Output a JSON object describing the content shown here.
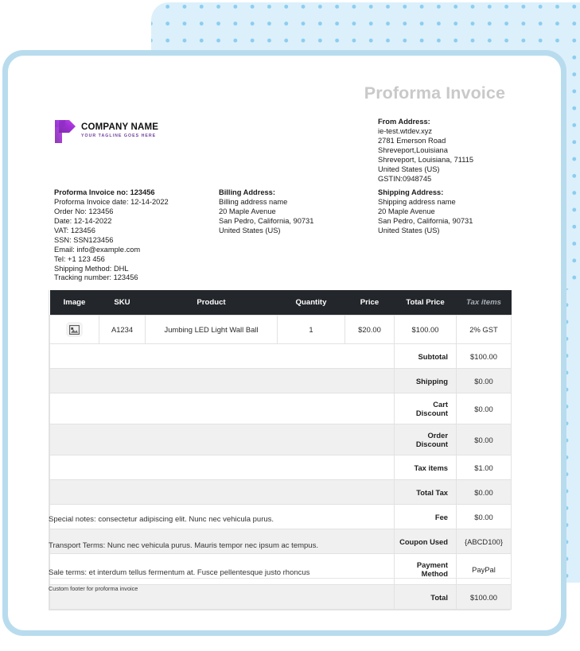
{
  "document": {
    "title": "Proforma Invoice"
  },
  "logo": {
    "name": "COMPANY NAME",
    "tagline": "YOUR TAGLINE GOES HERE",
    "mark_icon": "arrow-flag-logo-icon",
    "color_primary": "#a12fd6",
    "color_secondary": "#6d3f9e",
    "color_accent": "#3ecde0"
  },
  "from_address": {
    "heading": "From Address:",
    "lines": [
      "ie-test.wtdev.xyz",
      "2781 Emerson Road",
      "Shreveport,Louisiana",
      "Shreveport, Louisiana, 71115",
      "United States (US)",
      "GSTIN:0948745"
    ]
  },
  "invoice_info": {
    "heading": "Proforma Invoice no: 123456",
    "lines": [
      "Proforma Invoice date: 12-14-2022",
      "Order No: 123456",
      "Date: 12-14-2022",
      "VAT: 123456",
      "SSN: SSN123456",
      "Email: info@example.com",
      "Tel: +1 123 456",
      "Shipping Method: DHL",
      "Tracking number: 123456"
    ]
  },
  "billing_address": {
    "heading": "Billing Address:",
    "lines": [
      "Billing address name",
      "20 Maple Avenue",
      "San Pedro, California, 90731",
      "United States (US)"
    ]
  },
  "shipping_address": {
    "heading": "Shipping Address:",
    "lines": [
      "Shipping address name",
      "20 Maple Avenue",
      "San Pedro, California, 90731",
      "United States (US)"
    ]
  },
  "table": {
    "headers": {
      "image": "Image",
      "sku": "SKU",
      "product": "Product",
      "quantity": "Quantity",
      "price": "Price",
      "total_price": "Total Price",
      "tax_items": "Tax items"
    },
    "rows": [
      {
        "image_icon": "image-placeholder-icon",
        "sku": "A1234",
        "product": "Jumbing LED Light Wall Ball",
        "quantity": "1",
        "price": "$20.00",
        "total_price": "$100.00",
        "tax_items": "2% GST"
      }
    ],
    "summary": [
      {
        "label": "Subtotal",
        "value": "$100.00"
      },
      {
        "label": "Shipping",
        "value": "$0.00"
      },
      {
        "label": "Cart Discount",
        "value": "$0.00"
      },
      {
        "label": "Order Discount",
        "value": "$0.00"
      },
      {
        "label": "Tax items",
        "value": "$1.00"
      },
      {
        "label": "Total Tax",
        "value": "$0.00"
      },
      {
        "label": "Fee",
        "value": "$0.00"
      },
      {
        "label": "Coupon Used",
        "value": "{ABCD100}"
      },
      {
        "label": "Payment Method",
        "value": "PayPal"
      },
      {
        "label": "Total",
        "value": "$100.00"
      }
    ]
  },
  "notes": [
    "Special notes: consectetur adipiscing elit. Nunc nec vehicula purus.",
    "Transport Terms: Nunc nec vehicula purus. Mauris tempor nec ipsum ac tempus.",
    "Sale terms: et interdum tellus fermentum at. Fusce pellentesque justo rhoncus"
  ],
  "footer": {
    "text": "Custom footer for proforma invoice"
  },
  "theme": {
    "table_header_bg": "#23272b",
    "panel_blue": "#dcf0fb",
    "dot_blue": "#8ccdf0",
    "frame_blue": "#b8dcee",
    "title_gray": "#c9c9c9"
  }
}
